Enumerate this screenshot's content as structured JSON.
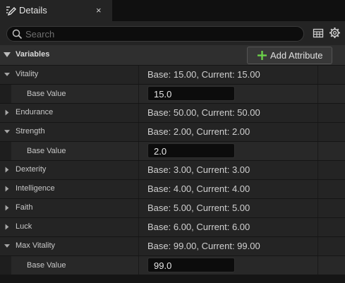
{
  "tab": {
    "title": "Details",
    "close": "×",
    "icon": "pencil-icon"
  },
  "search": {
    "placeholder": "Search",
    "value": ""
  },
  "toolbar": {
    "grid_icon": "table-icon",
    "settings_icon": "gear-icon"
  },
  "category": {
    "title": "Variables",
    "add_button": "Add Attribute",
    "add_icon": "plus-icon",
    "accent": "#6bd14a"
  },
  "attributes": [
    {
      "name": "Vitality",
      "value": "Base: 15.00, Current: 15.00",
      "expanded": true,
      "base_label": "Base Value",
      "base_value": "15.0"
    },
    {
      "name": "Endurance",
      "value": "Base: 50.00, Current: 50.00",
      "expanded": false
    },
    {
      "name": "Strength",
      "value": "Base: 2.00, Current: 2.00",
      "expanded": true,
      "base_label": "Base Value",
      "base_value": "2.0"
    },
    {
      "name": "Dexterity",
      "value": "Base: 3.00, Current: 3.00",
      "expanded": false
    },
    {
      "name": "Intelligence",
      "value": "Base: 4.00, Current: 4.00",
      "expanded": false
    },
    {
      "name": "Faith",
      "value": "Base: 5.00, Current: 5.00",
      "expanded": false
    },
    {
      "name": "Luck",
      "value": "Base: 6.00, Current: 6.00",
      "expanded": false
    },
    {
      "name": "Max Vitality",
      "value": "Base: 99.00, Current: 99.00",
      "expanded": true,
      "base_label": "Base Value",
      "base_value": "99.0"
    }
  ]
}
